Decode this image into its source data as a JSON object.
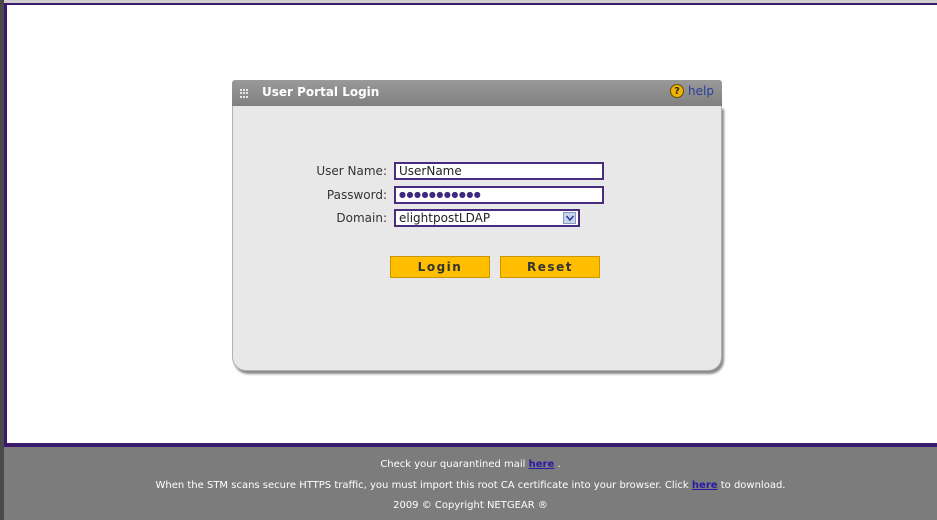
{
  "panel": {
    "title": "User Portal Login",
    "help_label": "help"
  },
  "form": {
    "username_label": "User Name:",
    "username_value": "UserName",
    "password_label": "Password:",
    "password_mask": "●●●●●●●●●●●",
    "domain_label": "Domain:",
    "domain_value": "elightpostLDAP",
    "login_label": "Login",
    "reset_label": "Reset"
  },
  "footer": {
    "line1_prefix": "Check your quarantined mail",
    "line1_link": "here",
    "line1_suffix": ".",
    "line2_prefix": "When the STM scans secure HTTPS traffic, you must import this root CA certificate into your browser. Click",
    "line2_link": "here",
    "line2_suffix": "to download.",
    "line3": "2009 © Copyright NETGEAR ®"
  },
  "colors": {
    "accent": "#3b1a6b",
    "button": "#ffbf00",
    "header": "#8c8c8c",
    "footer": "#7c7c7c"
  },
  "icons": {
    "grip": "grip-icon",
    "help": "help-icon",
    "dropdown": "chevron-down-icon"
  }
}
